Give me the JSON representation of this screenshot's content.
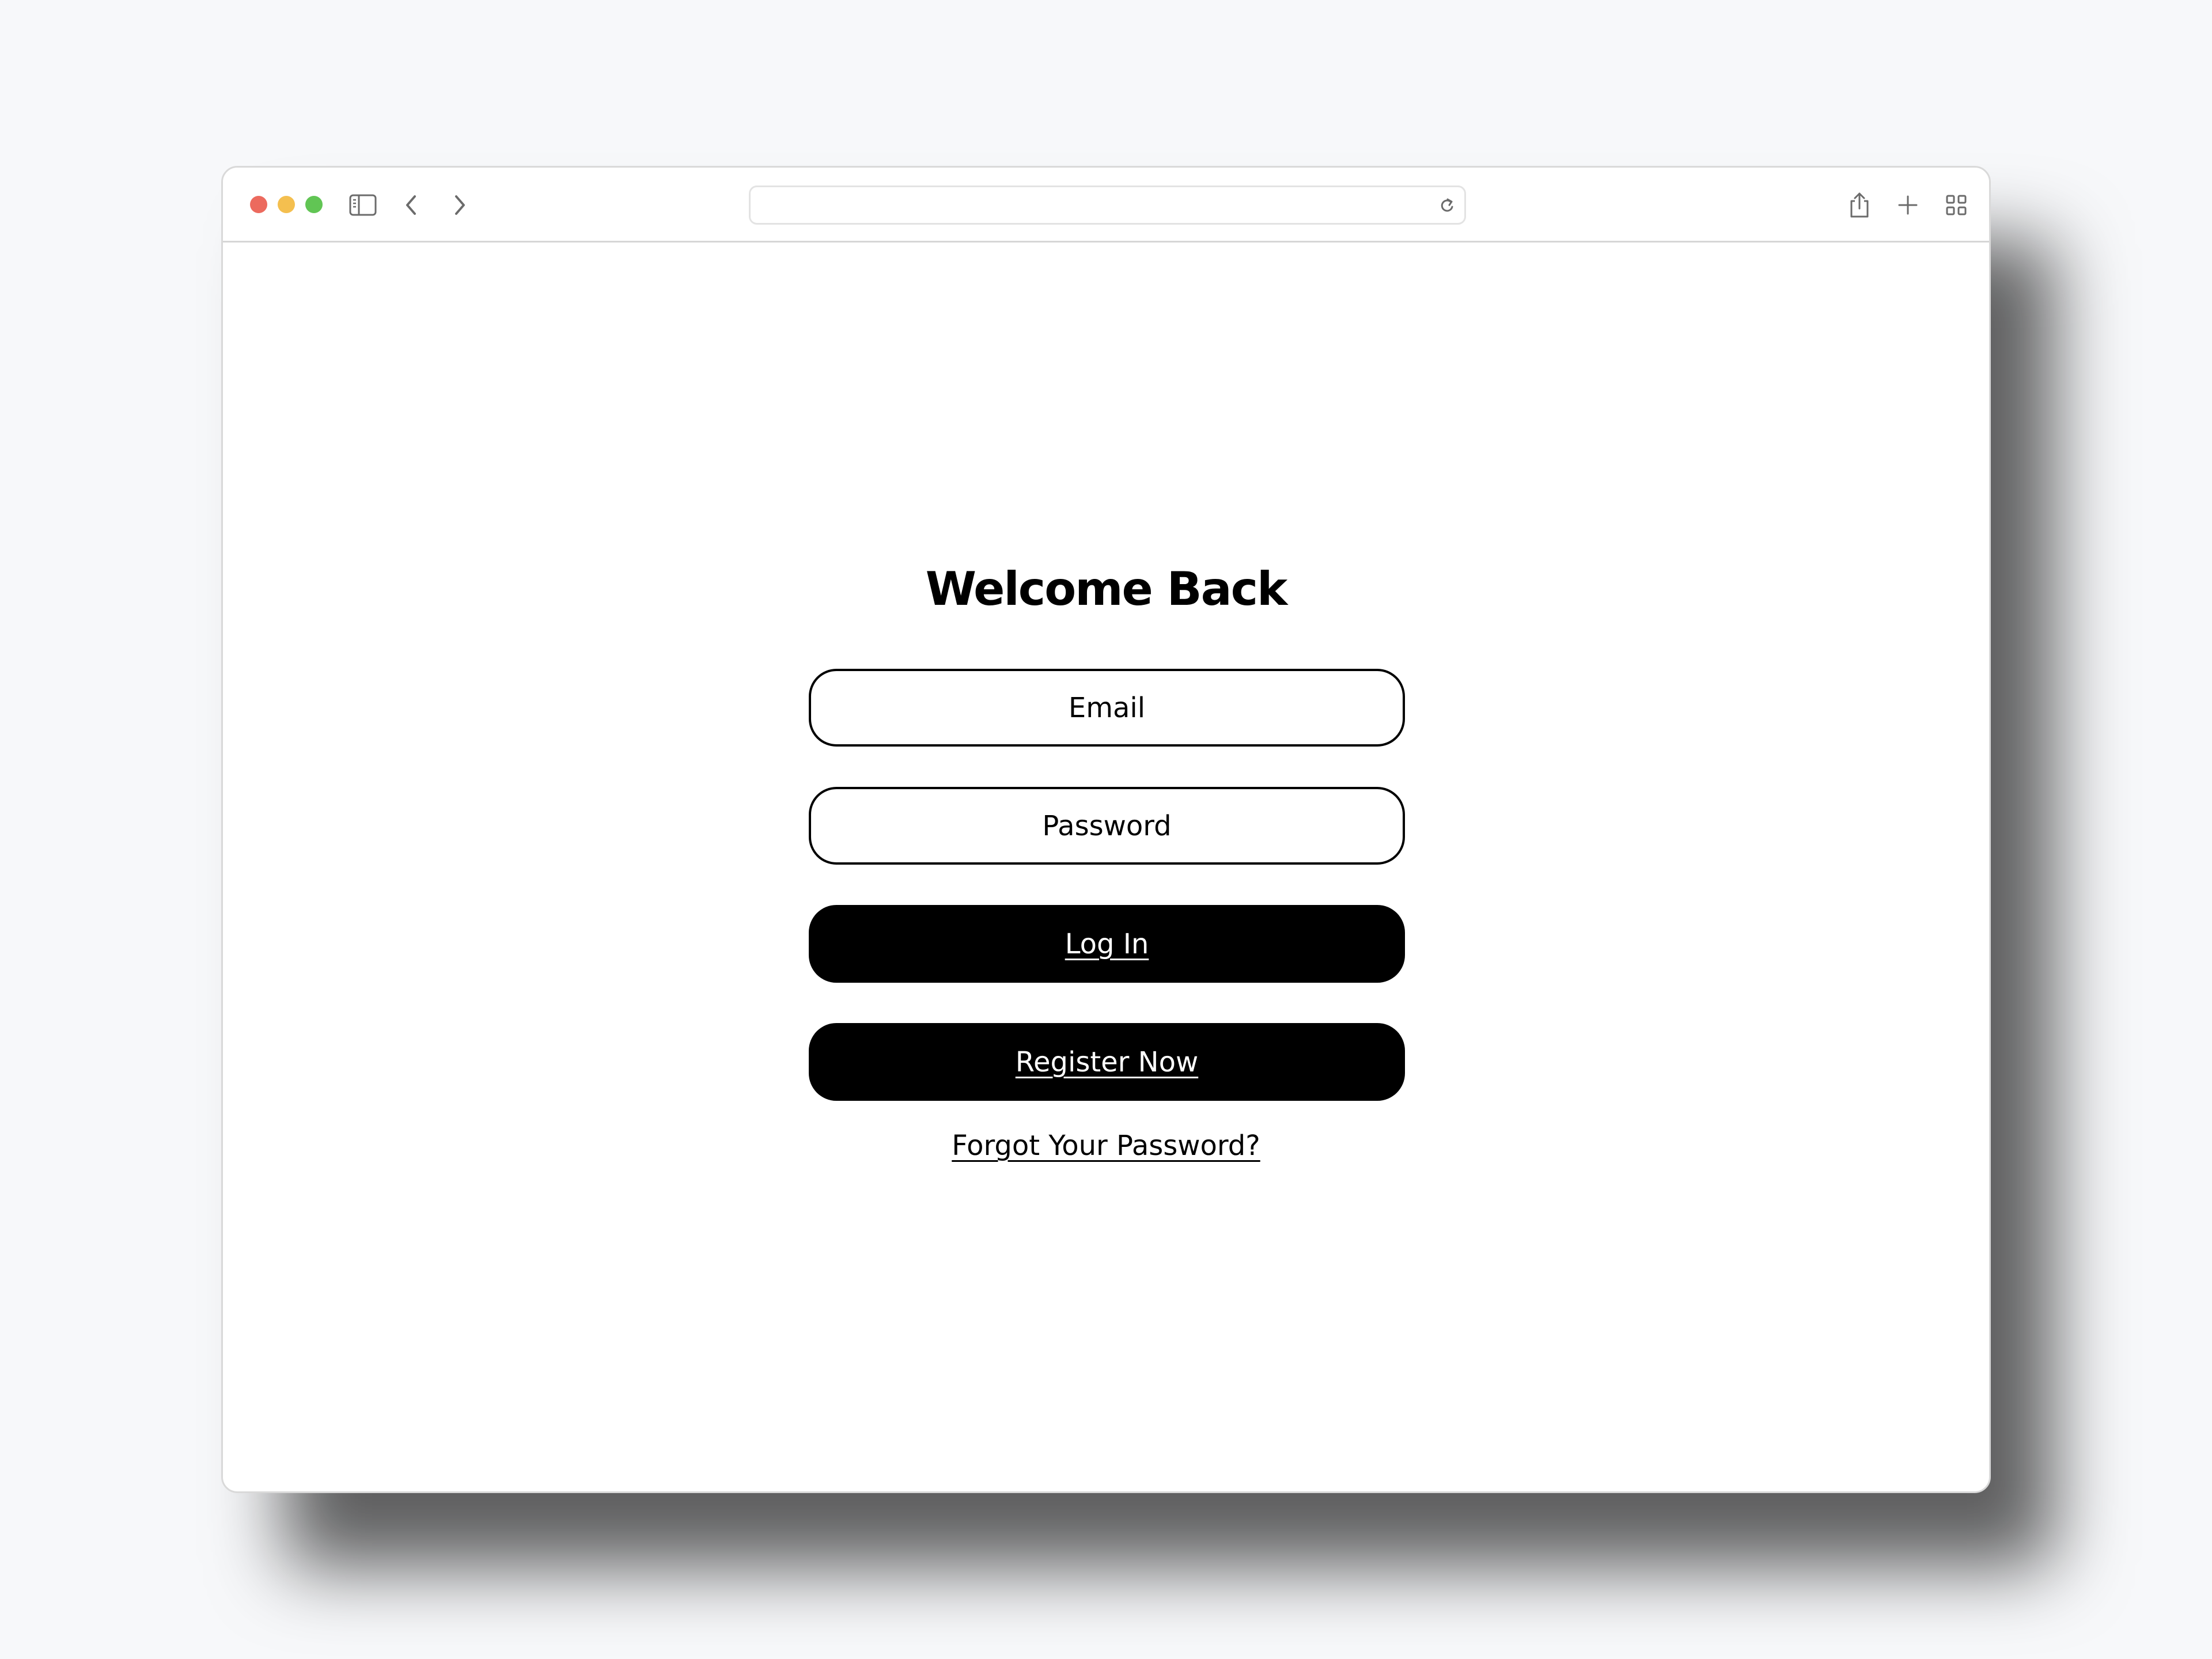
{
  "browser": {
    "address_bar": {
      "url": ""
    },
    "icons": {
      "sidebar": "sidebar-icon",
      "back": "chevron-left-icon",
      "forward": "chevron-right-icon",
      "reload": "reload-icon",
      "share": "share-icon",
      "new_tab": "plus-icon",
      "tab_overview": "grid-icon"
    },
    "traffic_lights": {
      "close": "#ec6a5e",
      "minimize": "#f4bf4f",
      "zoom": "#61c554"
    }
  },
  "login": {
    "title": "Welcome Back",
    "email_placeholder": "Email",
    "password_placeholder": "Password",
    "login_label": "Log In",
    "register_label": "Register Now",
    "forgot_label": "Forgot Your Password?"
  }
}
